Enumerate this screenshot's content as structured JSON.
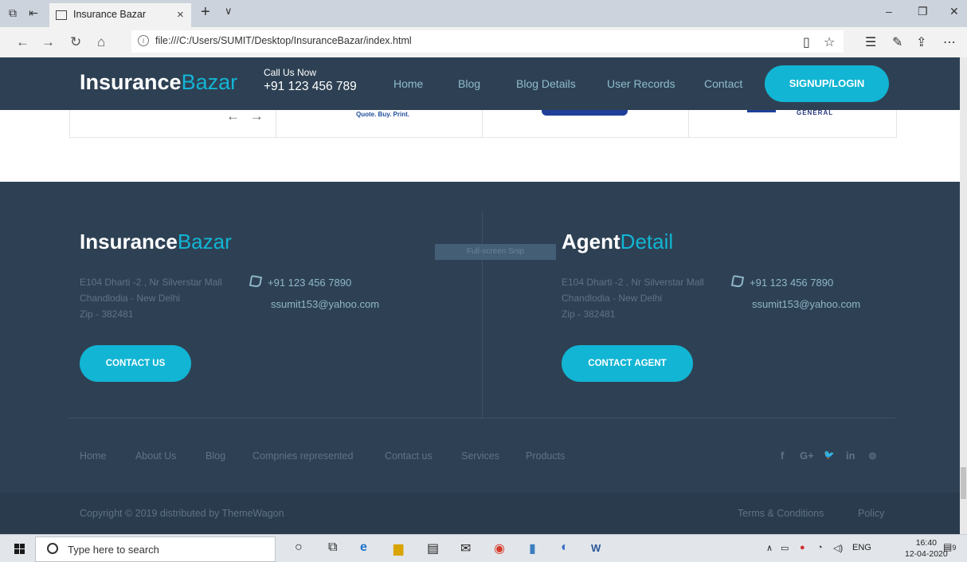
{
  "browser": {
    "tab_title": "Insurance Bazar",
    "tab_close": "×",
    "new_tab": "+",
    "tab_dropdown": "∨",
    "url": "file:///C:/Users/SUMIT/Desktop/InsuranceBazar/index.html",
    "window_minimize": "–",
    "window_restore": "❐",
    "window_close": "✕"
  },
  "header": {
    "logo_bold": "Insurance",
    "logo_light": "Bazar",
    "call_label": "Call Us Now",
    "call_number": "+91 123 456 789",
    "nav": [
      "Home",
      "Blog",
      "Blog Details",
      "User Records",
      "Contact"
    ],
    "signup_label": "SIGNUP/LOGIN"
  },
  "partners": {
    "arrows": "← →",
    "quote_logo_text": "Quote. Buy. Print.",
    "general_logo_text": "GENERAL"
  },
  "footer": {
    "left": {
      "logo_bold": "Insurance",
      "logo_light": "Bazar",
      "address_line1": "E104 Dharti -2 , Nr Silverstar Mall",
      "address_line2": "Chandlodia - New Delhi",
      "address_line3": "Zip - 382481",
      "phone": "+91 123 456 7890",
      "email": "ssumit153@yahoo.com",
      "button_label": "CONTACT US"
    },
    "right": {
      "logo_bold": "Agent",
      "logo_light": "Detail",
      "address_line1": "E104 Dharti -2 , Nr Silverstar Mall",
      "address_line2": "Chandlodia - New Delhi",
      "address_line3": "Zip - 382481",
      "phone": "+91 123 456 7890",
      "email": "ssumit153@yahoo.com",
      "button_label": "CONTACT AGENT"
    },
    "snip_overlay": "Full-screen Snip",
    "links": [
      "Home",
      "About Us",
      "Blog",
      "Compnies represented",
      "Contact us",
      "Services",
      "Products"
    ],
    "social": {
      "facebook": "f",
      "google_plus": "G+",
      "twitter": "🐦",
      "linkedin": "in",
      "pinterest": "⊚"
    },
    "copyright": "Copyright © 2019 distributed by ThemeWagon",
    "terms": "Terms & Conditions",
    "policy": "Policy"
  },
  "taskbar": {
    "search_placeholder": "Type here to search",
    "language": "ENG",
    "time": "16:40",
    "date": "12-04-2020",
    "notifications": "9"
  },
  "colors": {
    "header_bg": "#2e4154",
    "accent": "#12b5d4",
    "footer_bg": "#2e4154",
    "copyright_bg": "#293b4d"
  }
}
